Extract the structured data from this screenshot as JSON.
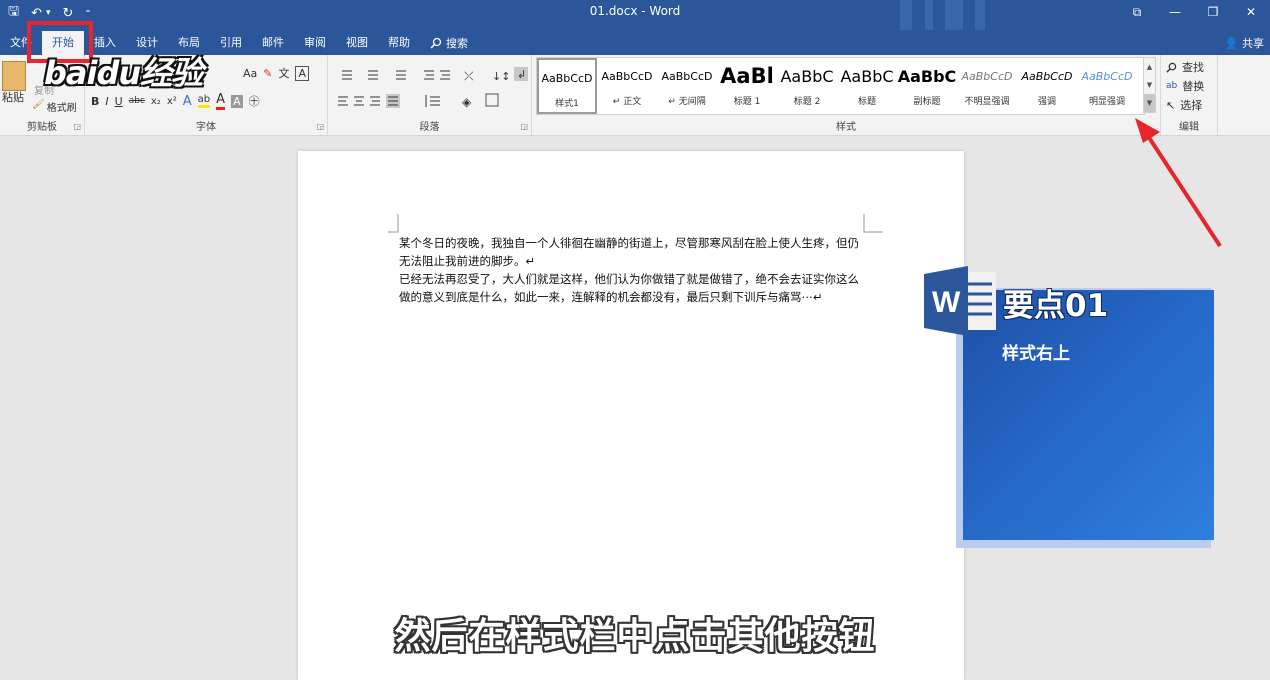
{
  "window": {
    "title": "01.docx - Word",
    "controls": [
      "⧉",
      "—",
      "❐",
      "✕"
    ]
  },
  "qat": {
    "save": "🖫",
    "undo": "↶",
    "undo_dropdown": "▾",
    "redo": "↻",
    "customize": "⁼"
  },
  "tabs": [
    "文件",
    "开始",
    "插入",
    "设计",
    "布局",
    "引用",
    "邮件",
    "审阅",
    "视图",
    "帮助"
  ],
  "active_tab": "开始",
  "tell_me": "搜索",
  "share": "共享",
  "ribbon": {
    "clipboard": {
      "label": "剪贴板",
      "paste": "粘贴",
      "copy": "复制",
      "format_painter": "格式刷"
    },
    "font": {
      "label": "字体",
      "size_button": "Aa",
      "text_effect": "A",
      "highlight": "ab",
      "font_color": "A",
      "char_shade": "A",
      "enclose": "㊉",
      "bold": "B",
      "italic": "I",
      "underline": "U",
      "strike": "abc",
      "sub": "x₂",
      "sup": "x²",
      "pinyin": "文",
      "border_char": "A"
    },
    "paragraph": {
      "label": "段落"
    },
    "styles": {
      "label": "样式",
      "items": [
        {
          "preview": "AaBbCcD",
          "name": "样式1"
        },
        {
          "preview": "AaBbCcD",
          "name": "↵ 正文"
        },
        {
          "preview": "AaBbCcD",
          "name": "↵ 无间隔"
        },
        {
          "preview": "AaBl",
          "name": "标题 1"
        },
        {
          "preview": "AaBbC",
          "name": "标题 2"
        },
        {
          "preview": "AaBbC",
          "name": "标题"
        },
        {
          "preview": "AaBbC",
          "name": "副标题"
        },
        {
          "preview": "AaBbCcD",
          "name": "不明显强调"
        },
        {
          "preview": "AaBbCcD",
          "name": "强调"
        },
        {
          "preview": "AaBbCcD",
          "name": "明显强调"
        }
      ]
    },
    "editing": {
      "label": "编辑",
      "find": "查找",
      "replace": "替换",
      "select": "选择"
    }
  },
  "document": {
    "paragraphs": [
      "某个冬日的夜晚，我独自一个人徘徊在幽静的街道上，尽管那寒风刮在脸上使人生疼，但仍无法阻止我前进的脚步。↵",
      "已经无法再忍受了，大人们就是这样，他们认为你做错了就是做错了，绝不会去证实你这么做的意义到底是什么，如此一来，连解释的机会都没有，最后只剩下训斥与痛骂⋯↵"
    ]
  },
  "watermark": "baidu经验",
  "overlay": {
    "logo_letter": "W",
    "title": "要点01",
    "subtitle": "样式右上"
  },
  "caption": "然后在样式栏中点击其他按钮",
  "colors": {
    "titlebar": "#2b579a",
    "accent_red": "#e8252b",
    "card_blue": "#2569c8"
  }
}
